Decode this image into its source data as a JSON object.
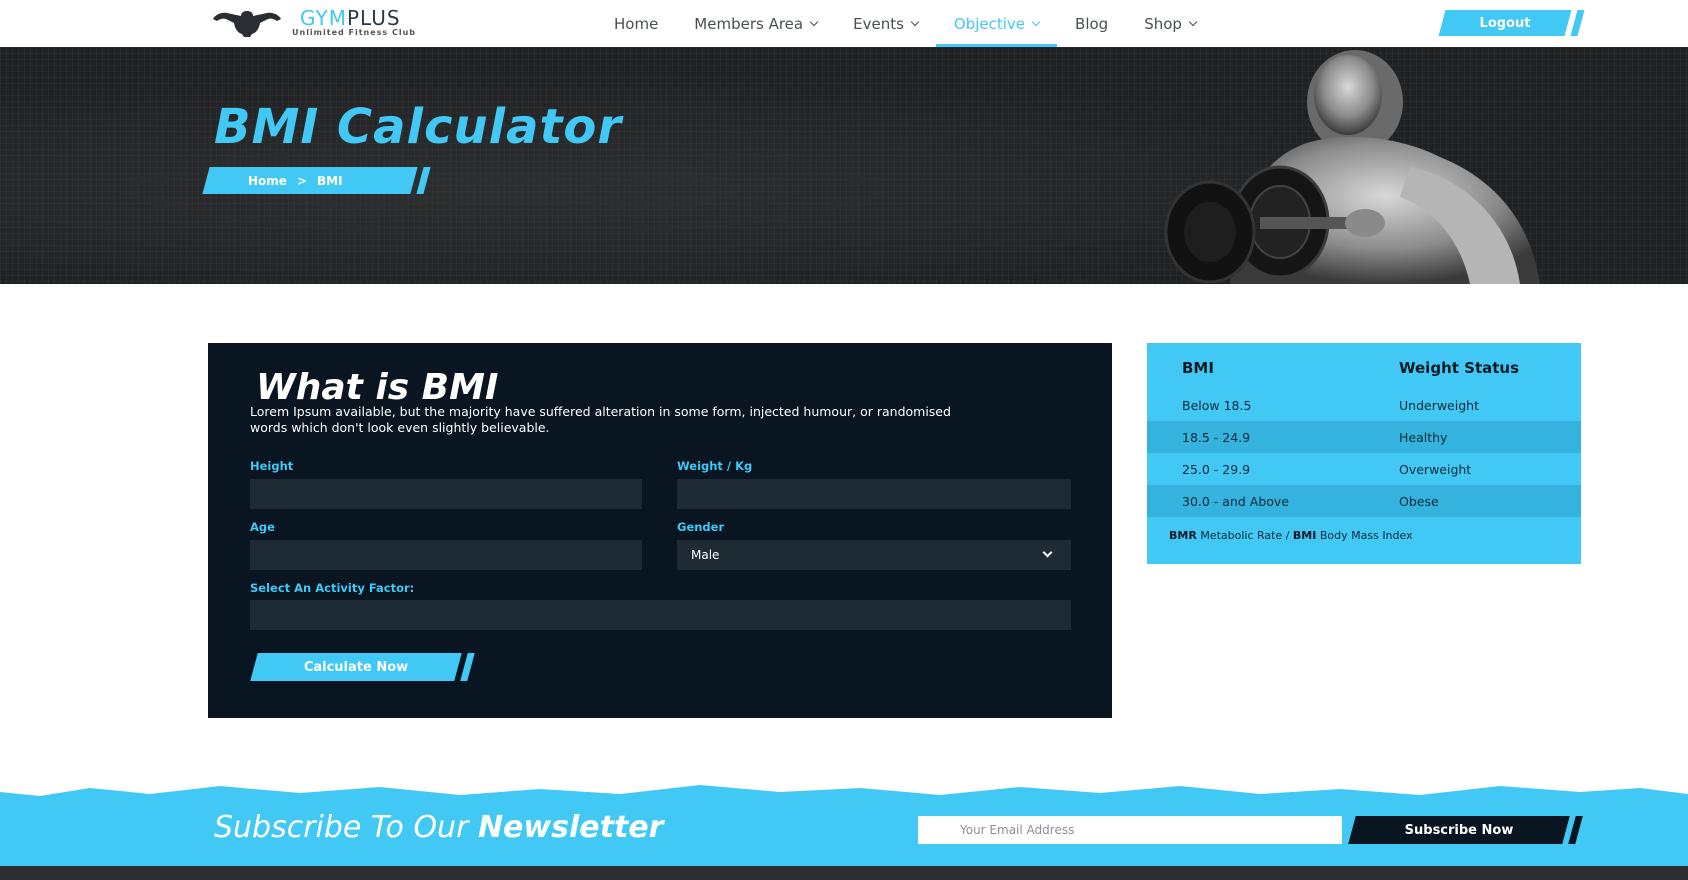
{
  "brand": {
    "name_part1": "GYM",
    "name_part2": "PLUS",
    "tagline": "Unlimited Fitness Club"
  },
  "nav": {
    "items": [
      {
        "label": "Home",
        "dropdown": false,
        "active": false
      },
      {
        "label": "Members Area",
        "dropdown": true,
        "active": false
      },
      {
        "label": "Events",
        "dropdown": true,
        "active": false
      },
      {
        "label": "Objective",
        "dropdown": true,
        "active": true
      },
      {
        "label": "Blog",
        "dropdown": false,
        "active": false
      },
      {
        "label": "Shop",
        "dropdown": true,
        "active": false
      }
    ],
    "logout_label": "Logout"
  },
  "hero": {
    "title": "BMI Calculator",
    "breadcrumb": {
      "home": "Home",
      "separator": ">",
      "current": "BMI"
    }
  },
  "form": {
    "title": "What is BMI",
    "description": "Lorem Ipsum available, but the majority have suffered alteration in some form, injected humour, or randomised words which don't look even slightly believable.",
    "height_label": "Height",
    "weight_label": "Weight / Kg",
    "age_label": "Age",
    "gender_label": "Gender",
    "gender_value": "Male",
    "activity_label": "Select An Activity Factor:",
    "submit_label": "Calculate Now"
  },
  "bmi_table": {
    "col_bmi": "BMI",
    "col_status": "Weight Status",
    "rows": [
      {
        "bmi": "Below 18.5",
        "status": "Underweight"
      },
      {
        "bmi": "18.5 - 24.9",
        "status": "Healthy"
      },
      {
        "bmi": "25.0 - 29.9",
        "status": "Overweight"
      },
      {
        "bmi": "30.0 - and Above",
        "status": "Obese"
      }
    ],
    "note_bmr_abbr": "BMR",
    "note_bmr_text": "Metabolic Rate /",
    "note_bmi_abbr": "BMI",
    "note_bmi_text": "Body Mass Index"
  },
  "newsletter": {
    "title_light": "Subscribe To Our",
    "title_bold": "Newsletter",
    "email_placeholder": "Your Email Address",
    "button_label": "Subscribe Now"
  },
  "colors": {
    "accent": "#41c8f5",
    "dark_panel": "#091520",
    "field_bg": "#1e2b35"
  }
}
